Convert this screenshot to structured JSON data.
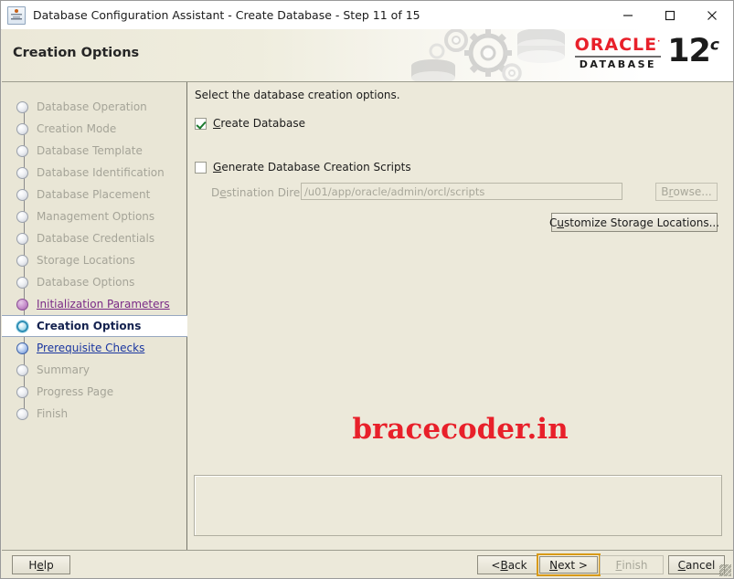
{
  "window": {
    "title": "Database Configuration Assistant - Create Database - Step 11 of 15",
    "icon": "database-assistant-icon",
    "minimize_label": "—",
    "maximize_label": "□",
    "close_label": "×"
  },
  "banner": {
    "page_title": "Creation Options",
    "brand_name": "ORACLE",
    "brand_registered": "·",
    "brand_product": "DATABASE",
    "brand_version": "12",
    "brand_version_suffix": "c"
  },
  "sidebar": {
    "items": [
      {
        "label": "Database Operation",
        "state": "done"
      },
      {
        "label": "Creation Mode",
        "state": "done"
      },
      {
        "label": "Database Template",
        "state": "done"
      },
      {
        "label": "Database Identification",
        "state": "done"
      },
      {
        "label": "Database Placement",
        "state": "done"
      },
      {
        "label": "Management Options",
        "state": "done"
      },
      {
        "label": "Database Credentials",
        "state": "done"
      },
      {
        "label": "Storage Locations",
        "state": "done"
      },
      {
        "label": "Database Options",
        "state": "done"
      },
      {
        "label": "Initialization Parameters",
        "state": "visited-link"
      },
      {
        "label": "Creation Options",
        "state": "active"
      },
      {
        "label": "Prerequisite Checks",
        "state": "next-link"
      },
      {
        "label": "Summary",
        "state": "done"
      },
      {
        "label": "Progress Page",
        "state": "done"
      },
      {
        "label": "Finish",
        "state": "done"
      }
    ]
  },
  "main": {
    "instruction": "Select the database creation options.",
    "create_database": {
      "label": "Create Database",
      "label_pre": "",
      "label_mnemonic": "C",
      "label_post": "reate Database",
      "checked": true
    },
    "generate_scripts": {
      "label": "Generate Database Creation Scripts",
      "label_pre": "",
      "label_mnemonic": "G",
      "label_post": "enerate Database Creation Scripts",
      "checked": false
    },
    "destination_directory": {
      "label_pre": "D",
      "label_mnemonic": "e",
      "label_post": "stination Directory:",
      "value": "/u01/app/oracle/admin/orcl/scripts",
      "enabled": false
    },
    "browse_button": {
      "label_pre": "B",
      "label_mnemonic": "r",
      "label_post": "owse...",
      "enabled": false
    },
    "customize_button": {
      "label_pre": "C",
      "label_mnemonic": "u",
      "label_post": "stomize Storage Locations...",
      "enabled": true
    },
    "watermark": "bracecoder.in",
    "message_panel_text": ""
  },
  "footer": {
    "help": {
      "pre": "H",
      "mnemonic": "e",
      "post": "lp"
    },
    "back": {
      "pre": "< ",
      "mnemonic": "B",
      "post": "ack"
    },
    "next": {
      "pre": "",
      "mnemonic": "N",
      "post": "ext >"
    },
    "finish": {
      "pre": "",
      "mnemonic": "F",
      "post": "inish",
      "enabled": false
    },
    "cancel": {
      "pre": "",
      "mnemonic": "C",
      "post": "ancel",
      "enabled": true
    }
  },
  "colors": {
    "window_bg": "#ece9da",
    "sidebar_bg": "#e9e6d6",
    "accent_orange": "#d89a17",
    "oracle_red": "#e8202a",
    "link_visited": "#7a2a86",
    "link_next": "#1a36a0",
    "disabled_text": "#a5a498"
  }
}
